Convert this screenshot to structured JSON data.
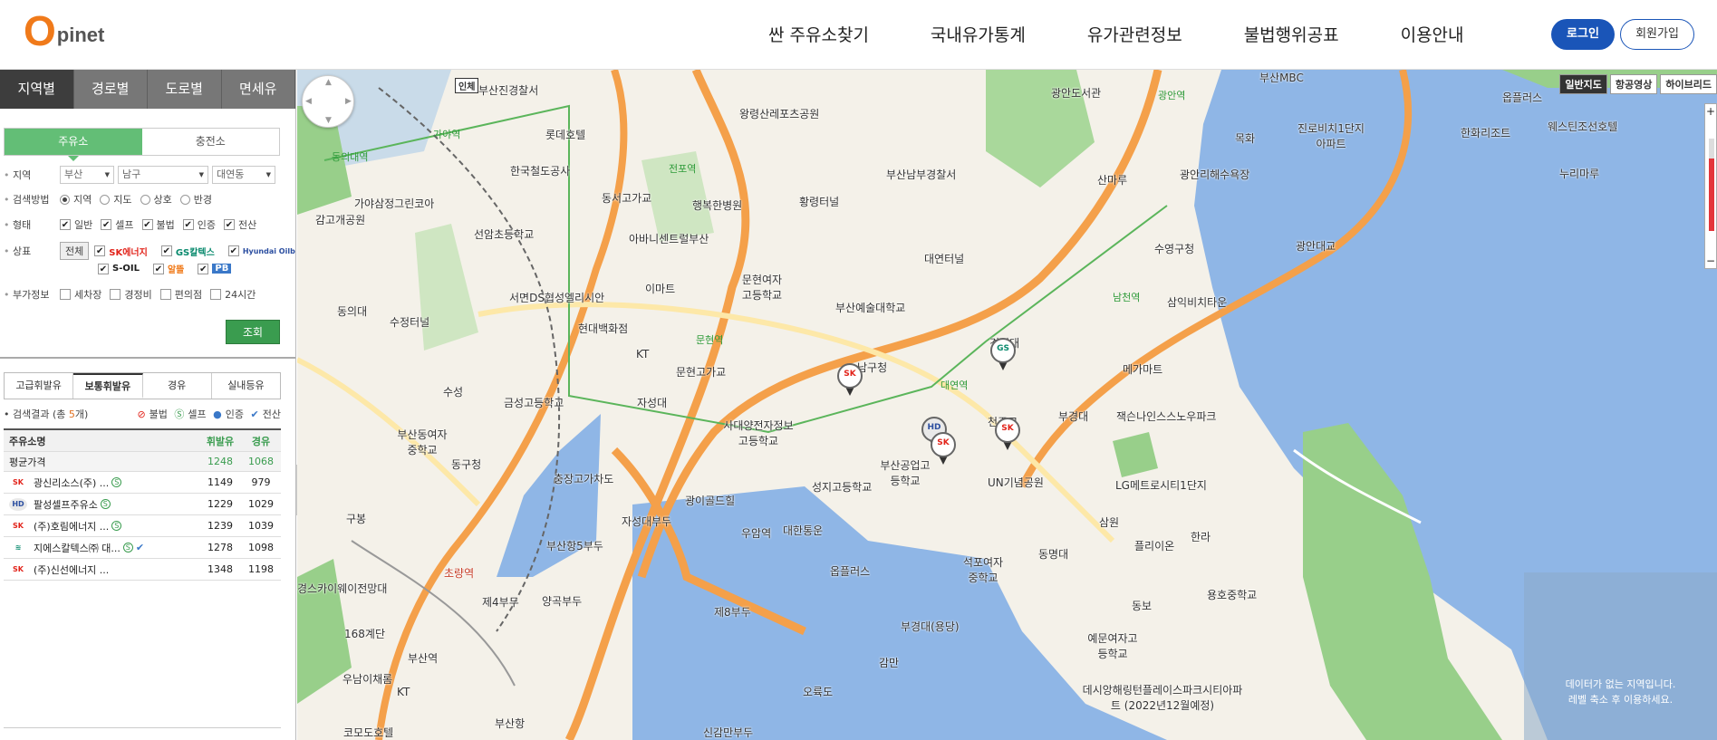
{
  "header": {
    "logo_o": "O",
    "logo_rest": "pinet",
    "nav": [
      "싼 주유소찾기",
      "국내유가통계",
      "유가관련정보",
      "불법행위공표",
      "이용안내"
    ],
    "login": "로그인",
    "join": "회원가입"
  },
  "side": {
    "tabs": [
      "지역별",
      "경로별",
      "도로별",
      "면세유"
    ],
    "type_tabs": [
      "주유소",
      "충전소"
    ],
    "region_label": "지역",
    "region": {
      "sido": "부산",
      "gugun": "남구",
      "dong": "대연동"
    },
    "method_label": "검색방법",
    "methods": [
      "지역",
      "지도",
      "상호",
      "반경"
    ],
    "shape_label": "형태",
    "shapes": [
      "일반",
      "셀프",
      "불법",
      "인증",
      "전산"
    ],
    "brand_label": "상표",
    "all_label": "전체",
    "brands": [
      "SK에너지",
      "GS칼텍스",
      "Hyundai Oilbank",
      "S-OIL",
      "알뜰",
      "PB"
    ],
    "extra_label": "부가정보",
    "extras": [
      "세차장",
      "경정비",
      "편의점",
      "24시간"
    ],
    "search_btn": "조회",
    "fuel_tabs": [
      "고급휘발유",
      "보통휘발유",
      "경유",
      "실내등유"
    ],
    "result_prefix": "검색결과 (총",
    "result_count": "5",
    "result_suffix": "개)",
    "legend": [
      "불법",
      "셀프",
      "인증",
      "전산"
    ],
    "table_headers": [
      "주유소명",
      "휘발유",
      "경유"
    ],
    "avg": {
      "name": "평균가격",
      "gas": "1248",
      "diesel": "1068"
    },
    "rows": [
      {
        "name": "광신리소스(주) ...",
        "gas": "1149",
        "diesel": "979",
        "brand": "SK"
      },
      {
        "name": "팔성셀프주유소",
        "gas": "1229",
        "diesel": "1029",
        "brand": "HD"
      },
      {
        "name": "(주)호림에너지 ...",
        "gas": "1239",
        "diesel": "1039",
        "brand": "SK"
      },
      {
        "name": "지에스칼텍스㈜ 대...",
        "gas": "1278",
        "diesel": "1098",
        "brand": "GS"
      },
      {
        "name": "(주)신선에너지 ...",
        "gas": "1348",
        "diesel": "1198",
        "brand": "SK"
      }
    ]
  },
  "map": {
    "types": [
      "일반지도",
      "항공영상",
      "하이브리드"
    ],
    "nodata": [
      "데이터가 없는 지역입니다.",
      "레벨 축소 후 이용하세요."
    ],
    "labels": [
      "부산진경찰서",
      "롯데호텔",
      "한국철도공사",
      "동서고가교",
      "행복한병원",
      "가야삼정그린코아",
      "선암초등학교",
      "아바니센트럴부산",
      "왕령산레포츠공원",
      "황령터널",
      "부산남부경찰서",
      "광안도서관",
      "광안역",
      "부산MBC",
      "옵플러스",
      "한화리조트",
      "웨스틴조선호텔",
      "누리마루",
      "진로비치1단지아파트",
      "목화",
      "광안리해수욕장",
      "산마루",
      "수영구청",
      "남천역",
      "삼익비치타운",
      "광안대교",
      "대연터널",
      "부산예술대학교",
      "문현여자고등학교",
      "이마트",
      "서면DS협성엘리시안",
      "현대백화점",
      "문현역",
      "문현고가교",
      "대연역",
      "남구청",
      "경성대",
      "메가마트",
      "부경대",
      "잭슨나인스스노우파크",
      "천주교",
      "LG메트로시티1단지",
      "UN기념공원",
      "성지고등학교",
      "부산공업고등학교",
      "사대양전자정보고등학교",
      "자성대",
      "수성",
      "금성고등학교",
      "부산동여자중학교",
      "동구청",
      "충장고가차도",
      "광이골드힐",
      "우암역",
      "대한통운",
      "옵플러스",
      "석포여자중학교",
      "부경대(용당)",
      "동명대",
      "삼원",
      "플리이온",
      "한라",
      "동보",
      "용호중학교",
      "예문여자고등학교",
      "데시앙해링턴플레이스파크시티아파트 (2022년12월예정)",
      "감만",
      "오륙도",
      "신감만부두",
      "제8부두",
      "양곡부두",
      "자성대부두",
      "부산항5부두",
      "제4부두",
      "초량역",
      "부산역",
      "168계단",
      "우남이채롬",
      "부산항",
      "코모도호텔",
      "경스카이웨이전망대",
      "구봉",
      "동의대",
      "감고개공원",
      "동의대역",
      "가야역",
      "수정터널",
      "전포역",
      "KT",
      "KT",
      "인체"
    ],
    "pins": [
      "SK",
      "GS",
      "HD",
      "SK",
      "SK"
    ]
  }
}
